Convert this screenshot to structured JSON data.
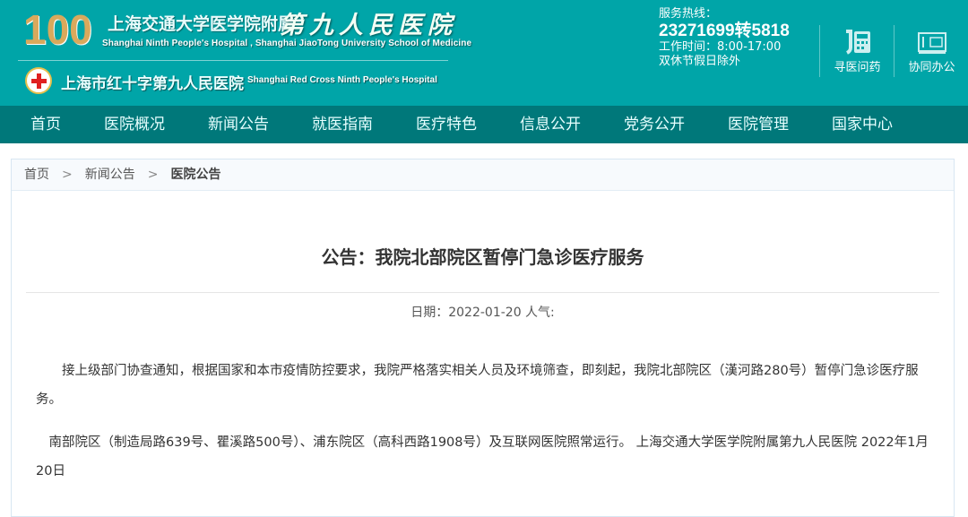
{
  "header": {
    "logo_number": "100",
    "org_cn": "上海交通大学医学院附属",
    "hospital_cn": "第九人民医院",
    "org_en": "Shanghai Ninth People's Hospital , Shanghai JiaoTong University School of Medicine",
    "redcross_cn": "上海市红十字第九人民医院",
    "redcross_en": "Shanghai Red Cross Ninth People's Hospital",
    "hotline_label": "服务热线：",
    "hotline": "23271699转5818",
    "hours": "工作时间：8:00-17:00",
    "holiday": "双休节假日除外",
    "quick_links": [
      {
        "label": "寻医问药",
        "icon": "phone-icon"
      },
      {
        "label": "协同办公",
        "icon": "office-icon"
      }
    ]
  },
  "nav": [
    "首页",
    "医院概况",
    "新闻公告",
    "就医指南",
    "医疗特色",
    "信息公开",
    "党务公开",
    "医院管理",
    "国家中心"
  ],
  "breadcrumb": [
    "首页",
    "新闻公告",
    "医院公告"
  ],
  "article": {
    "title": "公告：我院北部院区暂停门急诊医疗服务",
    "meta": "日期：2022-01-20 人气:",
    "paragraphs": [
      "接上级部门协查通知，根据国家和本市疫情防控要求，我院严格落实相关人员及环境筛查，即刻起，我院北部院区（漢河路280号）暂停门急诊医疗服务。",
      "南部院区（制造局路639号、瞿溪路500号）、浦东院区（高科西路1908号）及互联网医院照常运行。 上海交通大学医学院附属第九人民医院 2022年1月20日"
    ]
  }
}
